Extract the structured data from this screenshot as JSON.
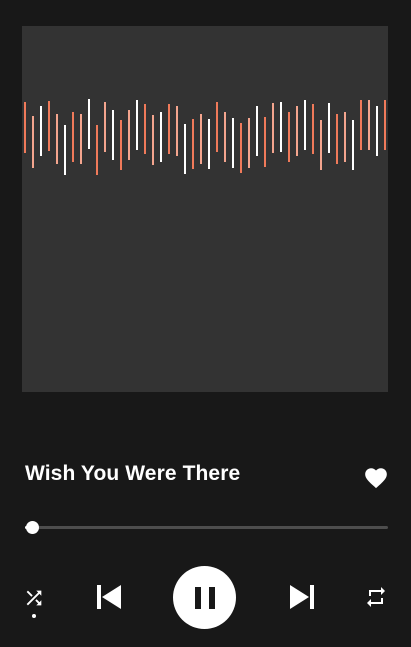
{
  "track": {
    "title": "Wish You Were There",
    "liked": true,
    "progress_fraction": 0.02,
    "shuffle_active": true
  },
  "artwork": {
    "background": "#333333",
    "bar_colors": [
      "#f07a5a",
      "#f4a58e",
      "#ffffff"
    ]
  },
  "colors": {
    "background": "#181818",
    "text": "#ffffff",
    "progress_track": "#4d4d4d",
    "accent": "#ffffff"
  },
  "icons": {
    "like": "heart-icon",
    "shuffle": "shuffle-icon",
    "previous": "skip-previous-icon",
    "play_pause": "pause-icon",
    "next": "skip-next-icon",
    "repeat": "repeat-icon"
  }
}
